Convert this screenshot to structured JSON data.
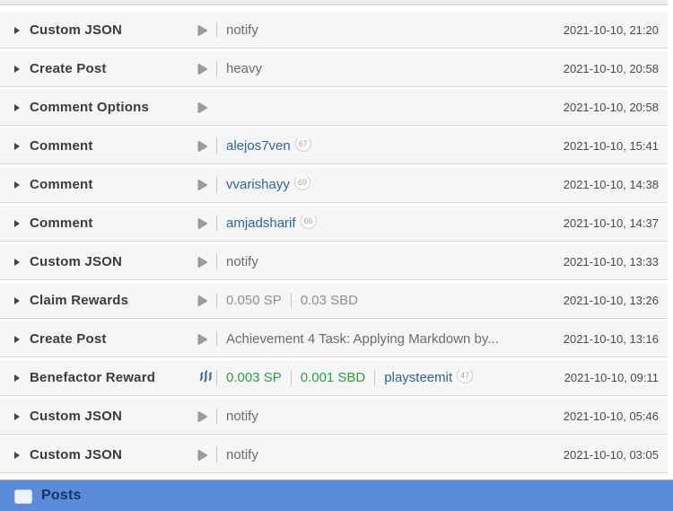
{
  "colors": {
    "accent_blue": "#5a8cdb",
    "link_blue": "#2b64a5",
    "green": "#28a13c",
    "row_bg": "#f6f6f6"
  },
  "footer": {
    "label": "Posts"
  },
  "rows": [
    {
      "operation": "Custom JSON",
      "icon": "play",
      "time": "2021-10-10, 21:20",
      "segments": [
        {
          "type": "text",
          "value": "notify"
        }
      ]
    },
    {
      "operation": "Create Post",
      "icon": "play",
      "time": "2021-10-10, 20:58",
      "segments": [
        {
          "type": "text",
          "value": "heavy"
        }
      ]
    },
    {
      "operation": "Comment Options",
      "icon": "play",
      "time": "2021-10-10, 20:58",
      "segments": []
    },
    {
      "operation": "Comment",
      "icon": "play",
      "time": "2021-10-10, 15:41",
      "segments": [
        {
          "type": "user",
          "value": "alejos7ven",
          "rep": "67"
        }
      ]
    },
    {
      "operation": "Comment",
      "icon": "play",
      "time": "2021-10-10, 14:38",
      "segments": [
        {
          "type": "user",
          "value": "vvarishayy",
          "rep": "69"
        }
      ]
    },
    {
      "operation": "Comment",
      "icon": "play",
      "time": "2021-10-10, 14:37",
      "segments": [
        {
          "type": "user",
          "value": "amjadsharif",
          "rep": "66"
        }
      ]
    },
    {
      "operation": "Custom JSON",
      "icon": "play",
      "time": "2021-10-10, 13:33",
      "segments": [
        {
          "type": "text",
          "value": "notify"
        }
      ]
    },
    {
      "operation": "Claim Rewards",
      "icon": "play",
      "time": "2021-10-10, 13:26",
      "segments": [
        {
          "type": "muted",
          "value": "0.050 SP"
        },
        {
          "type": "muted",
          "value": "0.03 SBD"
        }
      ]
    },
    {
      "operation": "Create Post",
      "icon": "play",
      "time": "2021-10-10, 13:16",
      "segments": [
        {
          "type": "text",
          "value": "Achievement 4 Task: Applying Markdown by..."
        }
      ]
    },
    {
      "operation": "Benefactor Reward",
      "icon": "steem",
      "time": "2021-10-10, 09:11",
      "segments": [
        {
          "type": "amount",
          "value": "0.003 SP"
        },
        {
          "type": "amount",
          "value": "0.001 SBD"
        },
        {
          "type": "user",
          "value": "playsteemit",
          "rep": "47"
        }
      ]
    },
    {
      "operation": "Custom JSON",
      "icon": "play",
      "time": "2021-10-10, 05:46",
      "segments": [
        {
          "type": "text",
          "value": "notify"
        }
      ]
    },
    {
      "operation": "Custom JSON",
      "icon": "play",
      "time": "2021-10-10, 03:05",
      "segments": [
        {
          "type": "text",
          "value": "notify"
        }
      ]
    }
  ]
}
